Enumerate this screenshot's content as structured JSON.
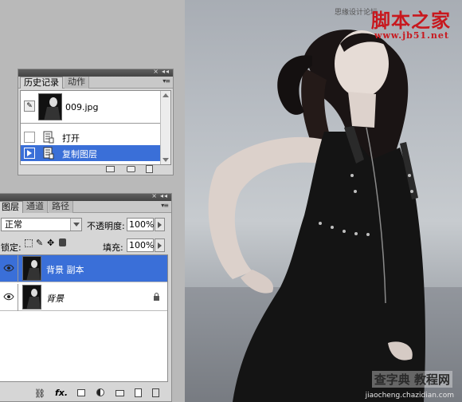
{
  "watermark": {
    "site_name": "脚本之家",
    "site_small": "思缘设计论坛",
    "site_url": "www.jb51.net",
    "bottom_name": "查字典 教程网",
    "bottom_url": "jiaocheng.chazidian.com",
    "brand_color": "#c8181e"
  },
  "history_panel": {
    "tabs": [
      {
        "label": "历史记录",
        "active": true
      },
      {
        "label": "动作",
        "active": false
      }
    ],
    "snapshot": {
      "name": "009.jpg"
    },
    "states": [
      {
        "label": "打开",
        "selected": false
      },
      {
        "label": "复制图层",
        "selected": true
      }
    ],
    "bottom_icons": [
      "new-document-from-state-icon",
      "camera-snapshot-icon",
      "trash-icon"
    ]
  },
  "layers_panel": {
    "tabs": [
      {
        "label": "图层",
        "active": true
      },
      {
        "label": "通道",
        "active": false
      },
      {
        "label": "路径",
        "active": false
      }
    ],
    "blend_mode": "正常",
    "opacity_label": "不透明度:",
    "opacity_value": "100%",
    "lock_label": "锁定:",
    "fill_label": "填充:",
    "fill_value": "100%",
    "layers": [
      {
        "name": "背景 副本",
        "selected": true,
        "visible": true,
        "locked": false
      },
      {
        "name": "背景",
        "selected": false,
        "visible": true,
        "locked": true
      }
    ],
    "bottom_icons": [
      "link-icon",
      "fx-icon",
      "mask-icon",
      "adjustment-icon",
      "folder-icon",
      "new-layer-icon",
      "trash-icon"
    ]
  },
  "selection_color": "#3a6fd8"
}
